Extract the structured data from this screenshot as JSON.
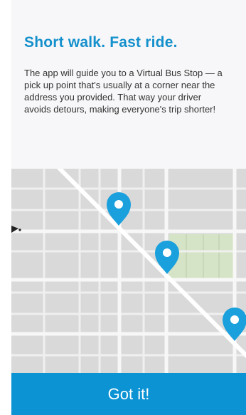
{
  "onboarding": {
    "title": "Short walk. Fast ride.",
    "body": "The app will guide you to a Virtual Bus Stop — a pick up point that's usually at a corner near the address you provided. That way your driver avoids detours, making everyone's trip shorter!",
    "primary_button_label": "Got it!"
  },
  "map": {
    "pin_icon": "map-pin-icon",
    "pin_count": 3,
    "colors": {
      "pin": "#1aa0dc",
      "block": "#d9d9d9",
      "street": "#f2f2f2",
      "park": "#d5e4c6"
    }
  },
  "colors": {
    "accent": "#1490cc",
    "button_background": "#0b93d3",
    "panel_background": "#f7f7f9"
  }
}
